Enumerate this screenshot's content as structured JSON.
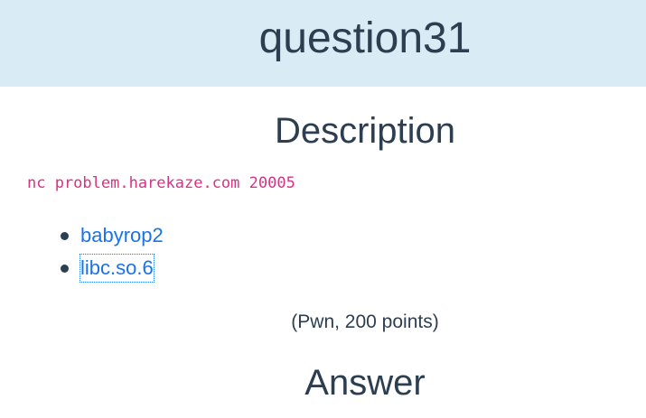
{
  "header": {
    "title": "question31"
  },
  "description": {
    "heading": "Description",
    "command": "nc problem.harekaze.com 20005",
    "files": [
      {
        "label": "babyrop2",
        "focused": false
      },
      {
        "label": "libc.so.6",
        "focused": true
      }
    ],
    "category": "(Pwn, 200 points)"
  },
  "answer": {
    "heading": "Answer"
  },
  "colors": {
    "header_bg": "#d9ecf5",
    "text": "#2c3e50",
    "link": "#1a73e8",
    "code": "#d63384"
  }
}
